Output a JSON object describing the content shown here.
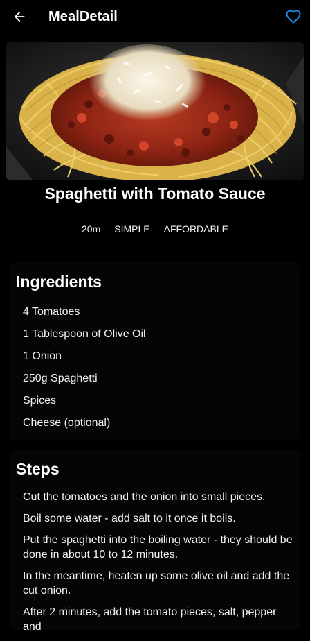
{
  "app_bar": {
    "title": "MealDetail",
    "back_icon": "arrow-back-icon",
    "favorite_icon": "heart-outline-icon",
    "accent_color": "#1e88e5"
  },
  "meal": {
    "image_alt": "Spaghetti with Tomato Sauce",
    "title": "Spaghetti with Tomato Sauce",
    "duration": "20m",
    "complexity": "SIMPLE",
    "affordability": "AFFORDABLE"
  },
  "ingredients": {
    "heading": "Ingredients",
    "items": [
      "4 Tomatoes",
      "1 Tablespoon of Olive Oil",
      "1 Onion",
      "250g Spaghetti",
      "Spices",
      "Cheese (optional)"
    ]
  },
  "steps": {
    "heading": "Steps",
    "items": [
      "Cut the tomatoes and the onion into small pieces.",
      "Boil some water - add salt to it once it boils.",
      "Put the spaghetti into the boiling water - they should be done in about 10 to 12 minutes.",
      "In the meantime, heaten up some olive oil and add the cut onion.",
      "After 2 minutes, add the tomato pieces, salt, pepper and"
    ]
  }
}
